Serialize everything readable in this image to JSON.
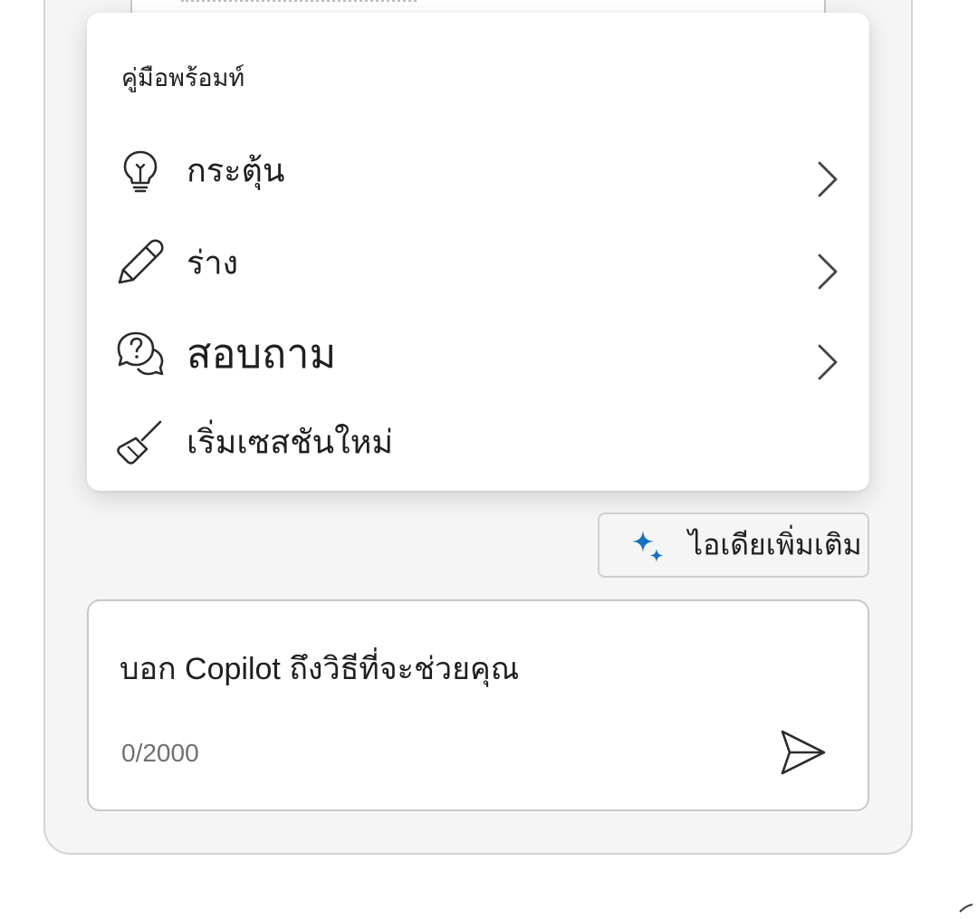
{
  "prompt_guide": {
    "heading": "คู่มือพร้อมท์",
    "items": [
      {
        "label": "กระตุ้น",
        "icon": "lightbulb-icon",
        "has_submenu": true
      },
      {
        "label": "ร่าง",
        "icon": "pencil-icon",
        "has_submenu": true
      },
      {
        "label": "สอบถาม",
        "icon": "chat-question-icon",
        "has_submenu": true
      },
      {
        "label": "เริ่มเซสชันใหม่",
        "icon": "broom-icon",
        "has_submenu": false
      }
    ]
  },
  "more_ideas": {
    "label": "ไอเดียเพิ่มเติม",
    "icon": "sparkle-icon",
    "icon_color": "#1a6fc4"
  },
  "composer": {
    "placeholder": "บอก Copilot ถึงวิธีที่จะช่วยคุณ",
    "value": "",
    "counter": "0/2000",
    "send_icon": "send-icon"
  }
}
